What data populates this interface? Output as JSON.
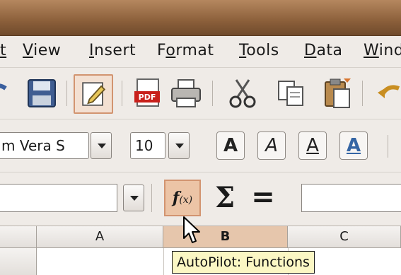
{
  "menubar": {
    "items": [
      {
        "pre": "",
        "mnemonic": "t",
        "post": ""
      },
      {
        "pre": "",
        "mnemonic": "V",
        "post": "iew"
      },
      {
        "pre": "",
        "mnemonic": "I",
        "post": "nsert"
      },
      {
        "pre": "F",
        "mnemonic": "o",
        "post": "rmat"
      },
      {
        "pre": "",
        "mnemonic": "T",
        "post": "ools"
      },
      {
        "pre": "",
        "mnemonic": "D",
        "post": "ata"
      },
      {
        "pre": "",
        "mnemonic": "W",
        "post": "ind"
      }
    ]
  },
  "toolbar": {
    "icons": [
      "undo-partial-icon",
      "save-icon",
      "edit-file-icon",
      "export-pdf-icon",
      "print-icon",
      "cut-icon",
      "copy-icon",
      "paste-icon",
      "undo-icon"
    ],
    "pdf_label": "PDF"
  },
  "format": {
    "font_name": "m Vera S",
    "font_size": "10",
    "bold_label": "A",
    "italic_label": "A",
    "underline_label": "A",
    "color_label": "A",
    "color_accent": "#3465a4"
  },
  "formula": {
    "fx_label": "f",
    "fx_sub": "(x)",
    "sum_label": "Σ",
    "equals_label": "=",
    "tooltip": "AutoPilot: Functions"
  },
  "grid": {
    "columns": [
      "A",
      "B",
      "C"
    ],
    "selected_column": "B"
  },
  "colors": {
    "titlebar": "#8b5f3a",
    "highlight": "#ecc4a6",
    "tooltip_bg": "#fbf7c4"
  }
}
